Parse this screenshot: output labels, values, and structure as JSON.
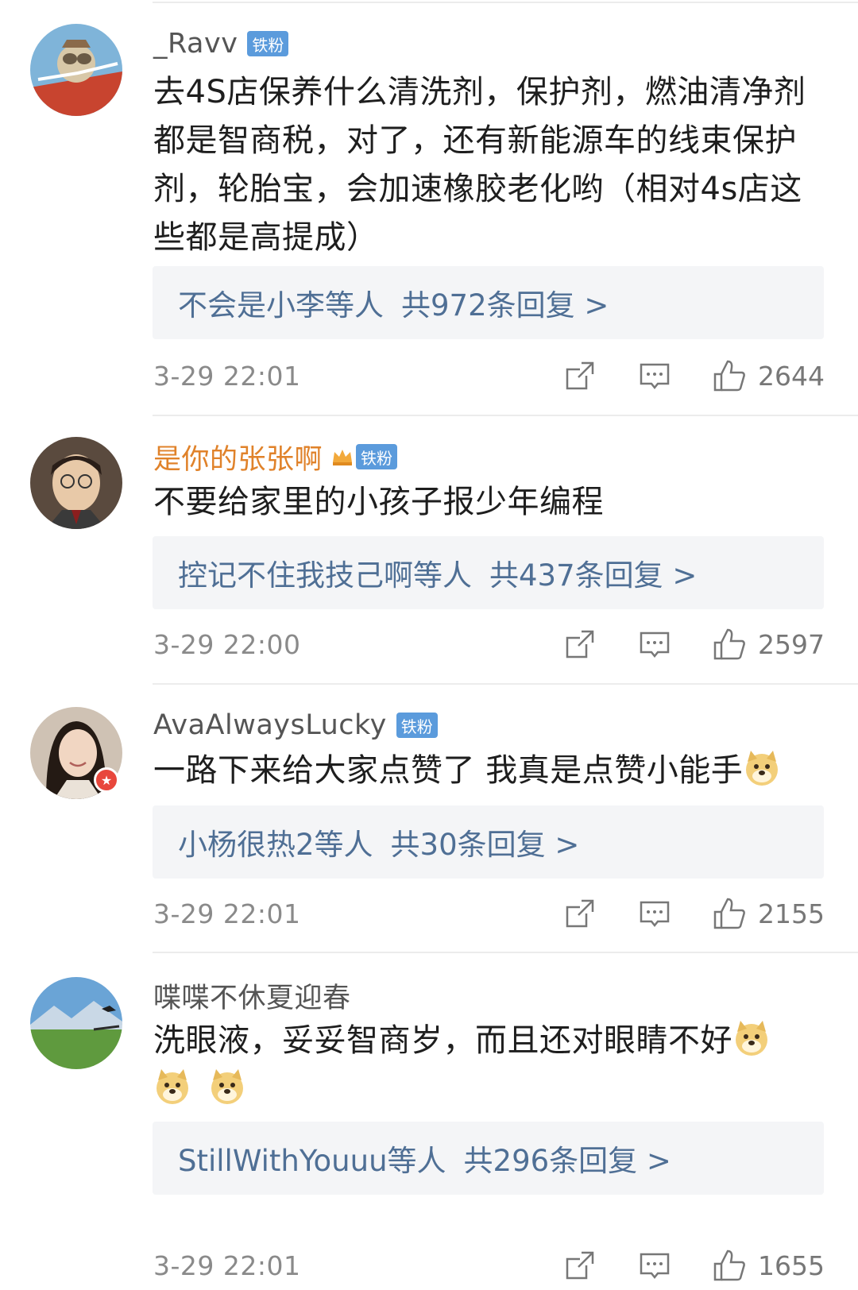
{
  "comments": [
    {
      "username": "_Ravv",
      "badge": "铁粉",
      "text": "去4S店保养什么清洗剂，保护剂，燃油清净剂都是智商税，对了，还有新能源车的线束保护剂，轮胎宝，会加速橡胶老化哟（相对4s店这些都是高提成）",
      "reply_users": "不会是小李等人",
      "reply_count": "共972条回复 >",
      "time": "3-29 22:01",
      "likes": "2644"
    },
    {
      "username": "是你的张张啊",
      "badge": "铁粉",
      "text": "不要给家里的小孩子报少年编程",
      "reply_users": "控记不住我技己啊等人",
      "reply_count": "共437条回复 >",
      "time": "3-29 22:00",
      "likes": "2597"
    },
    {
      "username": "AvaAlwaysLucky",
      "badge": "铁粉",
      "text": "一路下来给大家点赞了 我真是点赞小能手",
      "reply_users": "小杨很热2等人",
      "reply_count": "共30条回复 >",
      "time": "3-29 22:01",
      "likes": "2155"
    },
    {
      "username": "喋喋不休夏迎春",
      "text_line1": "洗眼液，妥妥智商岁，而且还对眼睛不好",
      "reply_users": "StillWithYouuu等人",
      "reply_count": "共296条回复 >",
      "time": "3-29 22:01",
      "likes": "1655"
    }
  ],
  "colors": {
    "reply_link": "#4f6f95",
    "vip_name": "#e0822a",
    "badge_bg": "#5b9bdc"
  },
  "icons": [
    "share-icon",
    "comment-icon",
    "thumbs-up-icon",
    "doge-emoji",
    "crown-icon"
  ]
}
